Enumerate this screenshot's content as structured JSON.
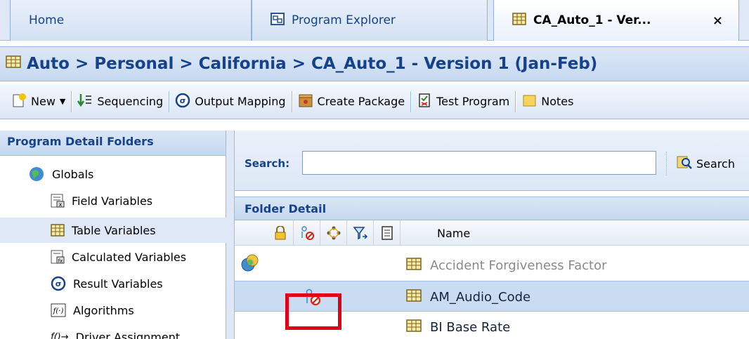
{
  "tabs": [
    {
      "label": "Home",
      "active": false
    },
    {
      "label": "Program Explorer",
      "active": false,
      "icon": "program-explorer-icon"
    },
    {
      "label": "CA_Auto_1 - Ver...",
      "active": true,
      "icon": "table-icon",
      "close": "×"
    }
  ],
  "breadcrumb": "Auto > Personal > California > CA_Auto_1 - Version 1 (Jan-Feb)",
  "toolbar": {
    "new_label": "New",
    "sequencing_label": "Sequencing",
    "output_mapping_label": "Output Mapping",
    "create_package_label": "Create Package",
    "test_program_label": "Test Program",
    "notes_label": "Notes"
  },
  "left_panel": {
    "title": "Program Detail Folders",
    "items": [
      {
        "label": "Globals",
        "icon": "globe-icon"
      },
      {
        "label": "Field Variables",
        "icon": "field-variables-icon"
      },
      {
        "label": "Table Variables",
        "icon": "table-icon",
        "selected": true
      },
      {
        "label": "Calculated Variables",
        "icon": "calculated-variables-icon"
      },
      {
        "label": "Result Variables",
        "icon": "result-variables-icon"
      },
      {
        "label": "Algorithms",
        "icon": "algorithm-icon"
      },
      {
        "label": "Driver Assignment",
        "icon": "driver-assignment-icon"
      }
    ]
  },
  "search": {
    "label": "Search:",
    "value": "",
    "button_label": "Search"
  },
  "folder_detail": {
    "title": "Folder Detail",
    "column_name": "Name",
    "column_icons": [
      "lock-icon",
      "user-blocked-icon",
      "dependency-icon",
      "filter-icon",
      "document-icon"
    ],
    "rows": [
      {
        "name": "Accident Forgiveness Factor",
        "dim": true,
        "status_icon": "shared-icon"
      },
      {
        "name": "AM_Audio_Code",
        "selected": true,
        "status_icon": "user-blocked-icon"
      },
      {
        "name": "BI Base Rate"
      }
    ]
  },
  "colors": {
    "accent": "#15428b",
    "header_bg": "#dfe8f6",
    "highlight_red": "#e0001a",
    "selected_row": "#c9dcf2"
  }
}
